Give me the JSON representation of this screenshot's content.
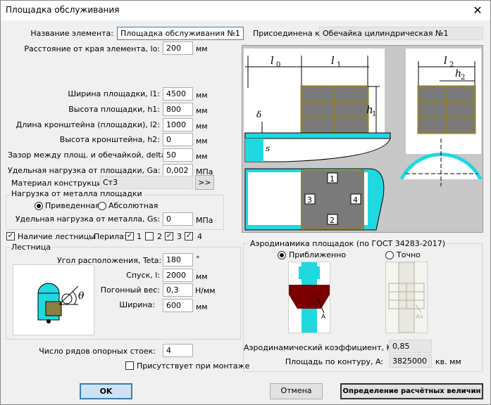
{
  "window": {
    "title": "Площадка обслуживания",
    "close": "✕"
  },
  "element": {
    "name_label": "Название элемента:",
    "name_value": "Площадка обслуживания №1",
    "attached_label": "Присоединена к:",
    "attached_value": "Обечайка цилиндрическая №1",
    "distance_label": "Расстояние от края элемента, lo:",
    "distance_value": "200",
    "distance_unit": "мм"
  },
  "params": [
    {
      "label": "Ширина площадки, l1:",
      "value": "4500",
      "unit": "мм"
    },
    {
      "label": "Высота площадки, h1:",
      "value": "800",
      "unit": "мм"
    },
    {
      "label": "Длина кронштейна (площадки), l2:",
      "value": "1000",
      "unit": "мм"
    },
    {
      "label": "Высота кронштейна, h2:",
      "value": "0",
      "unit": "мм"
    },
    {
      "label": "Зазор между площ. и обечайкой, delta:",
      "value": "50",
      "unit": "мм"
    },
    {
      "label": "Удельная нагрузка от площадки, Ga:",
      "value": "0,002",
      "unit": "МПа"
    }
  ],
  "material": {
    "label": "Материал конструкций:",
    "value": "Ст3",
    "button": ">>"
  },
  "metal_load": {
    "title": "Нагрузка от металла площадки",
    "opt1": "Приведенная",
    "opt2": "Абсолютная",
    "gs_label": "Удельная нагрузка от металла, Gs:",
    "gs_value": "0",
    "gs_unit": "МПа"
  },
  "ladders": {
    "present_label": "Наличие лестницы",
    "railing_label": "Перила:",
    "r1": "1",
    "r2": "2",
    "r3": "3",
    "r4": "4"
  },
  "ladder": {
    "title": "Лестница",
    "angle_label": "Угол расположения, Teta:",
    "angle_value": "180",
    "angle_unit": "°",
    "descent_label": "Спуск, l:",
    "descent_value": "2000",
    "descent_unit": "мм",
    "weight_label": "Погонный вес:",
    "weight_value": "0,3",
    "weight_unit": "Н/мм",
    "width_label": "Ширина:",
    "width_value": "600",
    "width_unit": "мм",
    "theta": "θ"
  },
  "support": {
    "rows_label": "Число рядов опорных стоек:",
    "rows_value": "4",
    "mount_label": "Присутствует при монтаже"
  },
  "aero": {
    "title": "Аэродинамика площадок (по ГОСТ 34283-2017)",
    "approx": "Приближенно",
    "exact": "Точно",
    "a_label": "A",
    "as_label": "As",
    "k_label": "Аэродинамический коэффициент, K:",
    "k_value": "0,85",
    "area_label": "Площадь по контуру, A:",
    "area_value": "3825000",
    "area_unit": "кв. мм"
  },
  "diagram": {
    "l0": "l",
    "l0s": "0",
    "l1": "l",
    "l1s": "1",
    "l2": "l",
    "l2s": "2",
    "h1": "h",
    "h1s": "1",
    "h2": "h",
    "h2s": "2",
    "delta": "δ",
    "s": "s",
    "n1": "1",
    "n2": "2",
    "n3": "3",
    "n4": "4"
  },
  "buttons": {
    "ok": "OK",
    "cancel": "Отмена",
    "calc": "Определение расчётных величин"
  },
  "colors": {
    "cyan": "#20d8e0",
    "olive": "#8b8040",
    "gray": "#c8c8c8",
    "dark": "#7a0000"
  }
}
